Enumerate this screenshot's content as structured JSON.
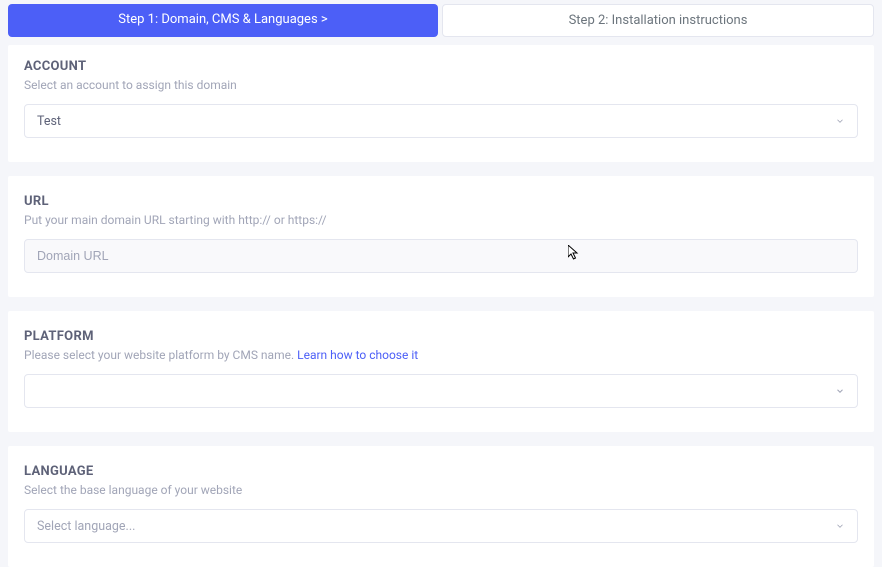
{
  "steps": {
    "step1": "Step 1: Domain, CMS & Languages  >",
    "step2": "Step 2: Installation instructions"
  },
  "account": {
    "title": "ACCOUNT",
    "desc": "Select an account to assign this domain",
    "value": "Test"
  },
  "url": {
    "title": "URL",
    "desc": "Put your main domain URL starting with http:// or https://",
    "placeholder": "Domain URL"
  },
  "platform": {
    "title": "PLATFORM",
    "desc": "Please select your website platform by CMS name.  ",
    "link_text": "Learn how to choose it",
    "value": ""
  },
  "language": {
    "title": "LANGUAGE",
    "desc": "Select the base language of your website",
    "placeholder": "Select language..."
  }
}
